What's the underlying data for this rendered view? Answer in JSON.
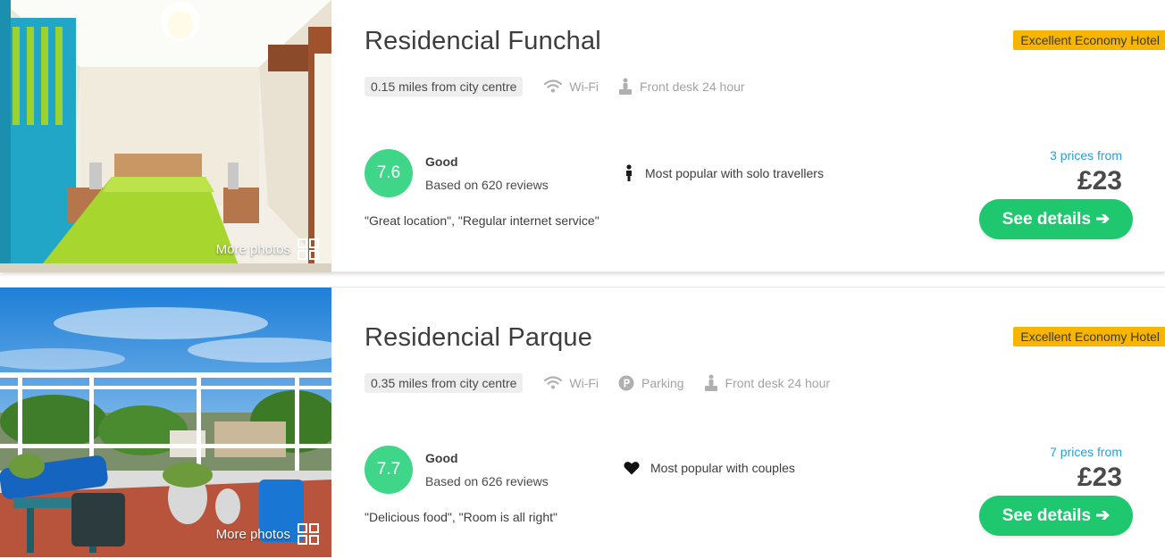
{
  "hotels": [
    {
      "name": "Residencial Funchal",
      "badge": "Excellent Economy Hotel",
      "more_photos": "More photos",
      "distance": "0.15 miles from city centre",
      "amenities": [
        "Wi-Fi",
        "Front desk 24 hour"
      ],
      "score": "7.6",
      "rating_word": "Good",
      "reviews": "Based on 620 reviews",
      "popular": "Most popular with solo travellers",
      "popular_icon": "person-icon",
      "quotes": "\"Great location\", \"Regular internet service\"",
      "prices_from": "3 prices from",
      "price": "£23",
      "cta": "See details ➔"
    },
    {
      "name": "Residencial Parque",
      "badge": "Excellent Economy Hotel",
      "more_photos": "More photos",
      "distance": "0.35 miles from city centre",
      "amenities": [
        "Wi-Fi",
        "Parking",
        "Front desk 24 hour"
      ],
      "score": "7.7",
      "rating_word": "Good",
      "reviews": "Based on 626 reviews",
      "popular": "Most popular with couples",
      "popular_icon": "heart-icon",
      "quotes": "\"Delicious food\", \"Room is all right\"",
      "prices_from": "7 prices from",
      "price": "£23",
      "cta": "See details ➔"
    }
  ],
  "colors": {
    "score_green": "#3fd68a",
    "cta_green": "#1fc86f",
    "badge_yellow": "#f7b500",
    "link_blue": "#2a9fd6"
  }
}
